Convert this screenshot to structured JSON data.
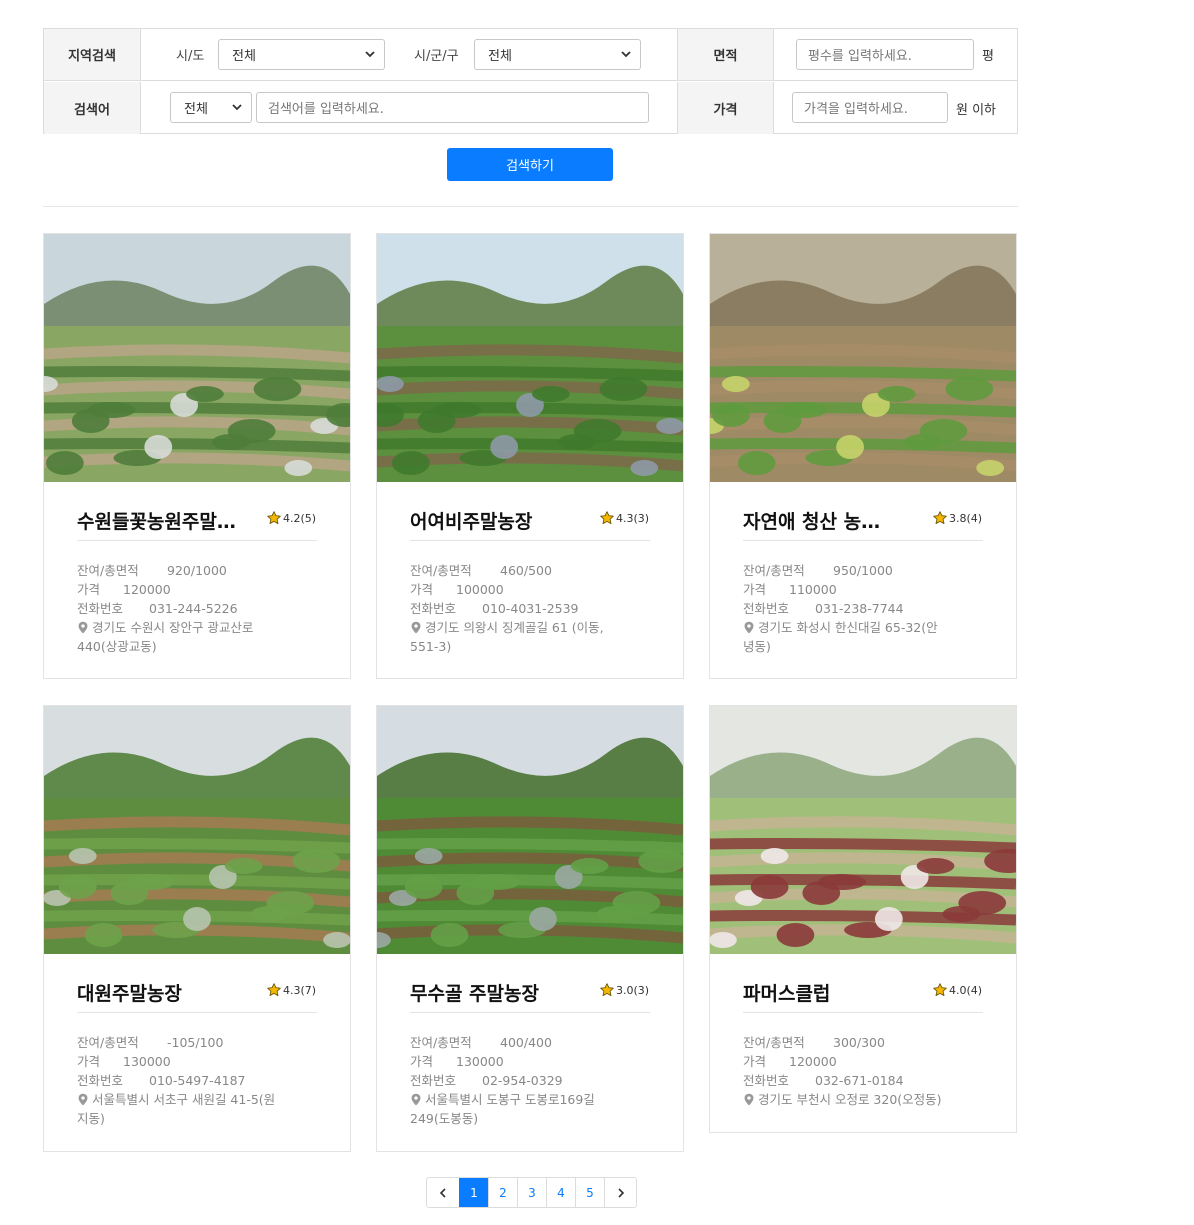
{
  "search": {
    "region_label": "지역검색",
    "sido_label": "시/도",
    "sido_value": "전체",
    "sigungu_label": "시/군/구",
    "sigungu_value": "전체",
    "area_label": "면적",
    "area_placeholder": "평수를 입력하세요.",
    "area_unit": "평",
    "keyword_label": "검색어",
    "keyword_type_value": "전체",
    "keyword_placeholder": "검색어를 입력하세요.",
    "price_label": "가격",
    "price_placeholder": "가격을 입력하세요.",
    "price_unit": "원 이하",
    "button_label": "검색하기"
  },
  "labels": {
    "area": "잔여/총면적",
    "price": "가격",
    "phone": "전화번호"
  },
  "farms": [
    {
      "name": "수원들꽃농원주말…",
      "rating": "4.2(5)",
      "area": "920/1000",
      "price": "120000",
      "phone": "031-244-5226",
      "address_1": "경기도 수원시 장안구 광교산로",
      "address_2": "440(상광교동)"
    },
    {
      "name": "어여비주말농장",
      "rating": "4.3(3)",
      "area": "460/500",
      "price": "100000",
      "phone": "010-4031-2539",
      "address_1": "경기도 의왕시 징계골길 61 (이동,",
      "address_2": "551-3)"
    },
    {
      "name": "자연애 청산 농…",
      "rating": "3.8(4)",
      "area": "950/1000",
      "price": "110000",
      "phone": "031-238-7744",
      "address_1": "경기도 화성시 한신대길 65-32(안",
      "address_2": "녕동)"
    },
    {
      "name": "대원주말농장",
      "rating": "4.3(7)",
      "area": "-105/100",
      "price": "130000",
      "phone": "010-5497-4187",
      "address_1": "서울특별시 서초구 새원길 41-5(원",
      "address_2": "지동)"
    },
    {
      "name": "무수골 주말농장",
      "rating": "3.0(3)",
      "area": "400/400",
      "price": "130000",
      "phone": "02-954-0329",
      "address_1": "서울특별시 도봉구 도봉로169길",
      "address_2": "249(도봉동)"
    },
    {
      "name": "파머스클럽",
      "rating": "4.0(4)",
      "area": "300/300",
      "price": "120000",
      "phone": "032-671-0184",
      "address_1": "경기도 부천시 오정로 320(오정동)",
      "address_2": ""
    }
  ],
  "pagination": {
    "pages": [
      "1",
      "2",
      "3",
      "4",
      "5"
    ],
    "active": "1",
    "prev_icon": "chevron-left-icon",
    "next_icon": "chevron-right-icon"
  },
  "colors": {
    "accent": "#0a7cff",
    "star": "#f5b800"
  }
}
